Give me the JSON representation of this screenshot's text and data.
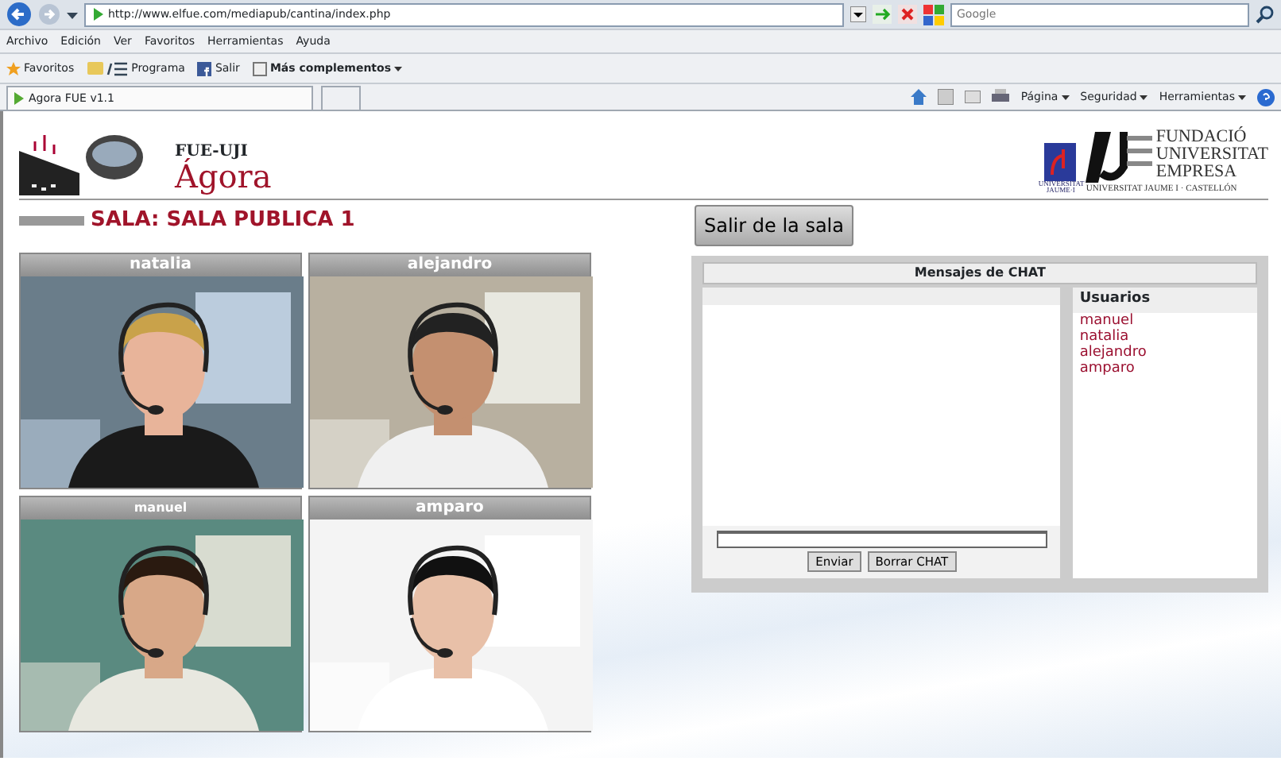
{
  "browser": {
    "address": "http://www.elfue.com/mediapub/cantina/index.php",
    "search": {
      "placeholder": "Google"
    },
    "menu": [
      "Archivo",
      "Edición",
      "Ver",
      "Favoritos",
      "Herramientas",
      "Ayuda"
    ],
    "favorites": [
      {
        "label": "Favoritos",
        "kind": "star"
      },
      {
        "label": "Programa",
        "kind": "logo"
      },
      {
        "label": "Salir",
        "kind": "facebook"
      },
      {
        "label": "Más complementos",
        "kind": "addons"
      }
    ],
    "tab": {
      "title": "Agora FUE v1.1"
    },
    "commands": [
      "Página",
      "Seguridad",
      "Herramientas"
    ]
  },
  "header": {
    "brand": "FUE-UJI",
    "app": "Ágora",
    "uji_logo": "UNIVERSITAT JAUME·I",
    "fue_logo": [
      "FUNDACIÓ",
      "UNIVERSITAT",
      "EMPRESA"
    ],
    "fue_caption": "UNIVERSITAT JAUME I · CASTELLÓN"
  },
  "room": {
    "title": "SALA: SALA PUBLICA 1",
    "leave_button": "Salir de la sala"
  },
  "videos": [
    {
      "name": "natalia",
      "kind": "picture"
    },
    {
      "name": "alejandro",
      "kind": "picture"
    },
    {
      "name": "manuel",
      "kind": "picture"
    },
    {
      "name": "amparo",
      "kind": "picture"
    }
  ],
  "chat": {
    "title": "Mensajes de CHAT",
    "users_heading": "Usuarios",
    "users": [
      "manuel",
      "natalia",
      "alejandro",
      "amparo"
    ],
    "send_button": "Enviar",
    "clear_button": "Borrar CHAT"
  }
}
